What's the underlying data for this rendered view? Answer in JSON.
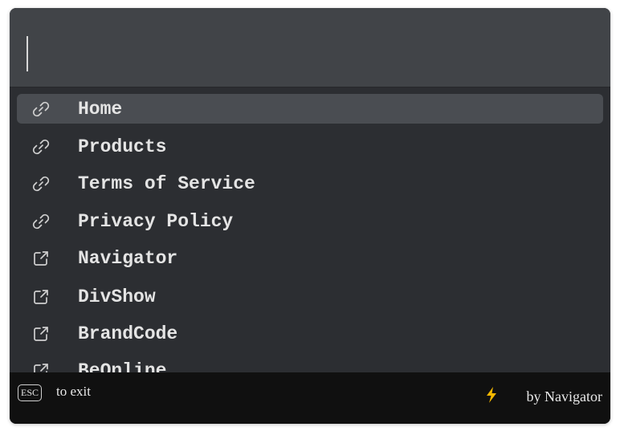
{
  "search": {
    "value": "",
    "placeholder": ""
  },
  "results": [
    {
      "label": "Home",
      "icon": "link-icon",
      "selected": true
    },
    {
      "label": "Products",
      "icon": "link-icon",
      "selected": false
    },
    {
      "label": "Terms of Service",
      "icon": "link-icon",
      "selected": false
    },
    {
      "label": "Privacy Policy",
      "icon": "link-icon",
      "selected": false
    },
    {
      "label": "Navigator",
      "icon": "external-link-icon",
      "selected": false
    },
    {
      "label": "DivShow",
      "icon": "external-link-icon",
      "selected": false
    },
    {
      "label": "BrandCode",
      "icon": "external-link-icon",
      "selected": false
    },
    {
      "label": "BeOnline",
      "icon": "external-link-icon",
      "selected": false
    }
  ],
  "footer": {
    "esc_key": "ESC",
    "exit_label": "to exit",
    "brand_icon": "lightning-icon",
    "brand_label": "by Navigator"
  },
  "colors": {
    "search_background": "#414448",
    "list_background": "#2c2e32",
    "selected_background": "#4a4d52",
    "footer_background": "#101010",
    "bolt": "#f5b800"
  }
}
